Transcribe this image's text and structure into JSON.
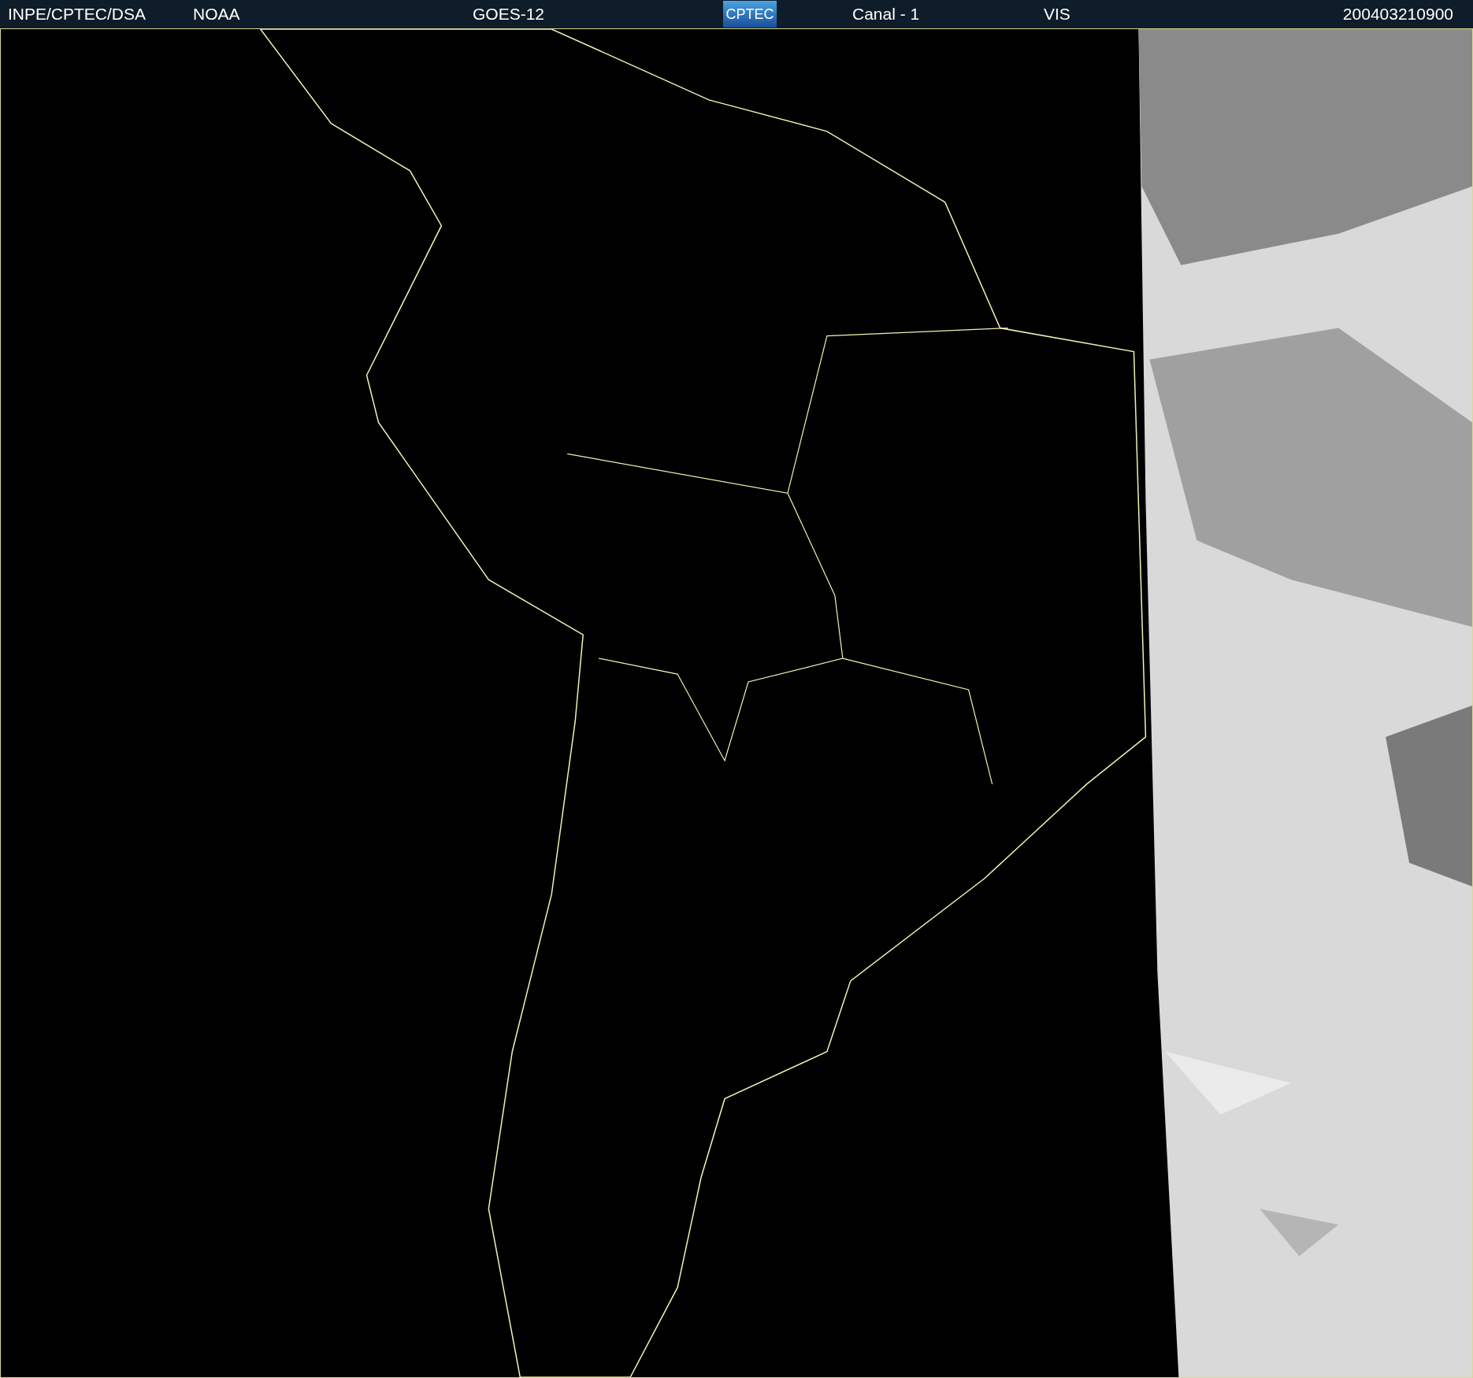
{
  "header": {
    "source": "INPE/CPTEC/DSA",
    "agency": "NOAA",
    "satellite": "GOES-12",
    "logo": "CPTEC",
    "channel": "Canal - 1",
    "band": "VIS",
    "timestamp": "200403210900"
  }
}
